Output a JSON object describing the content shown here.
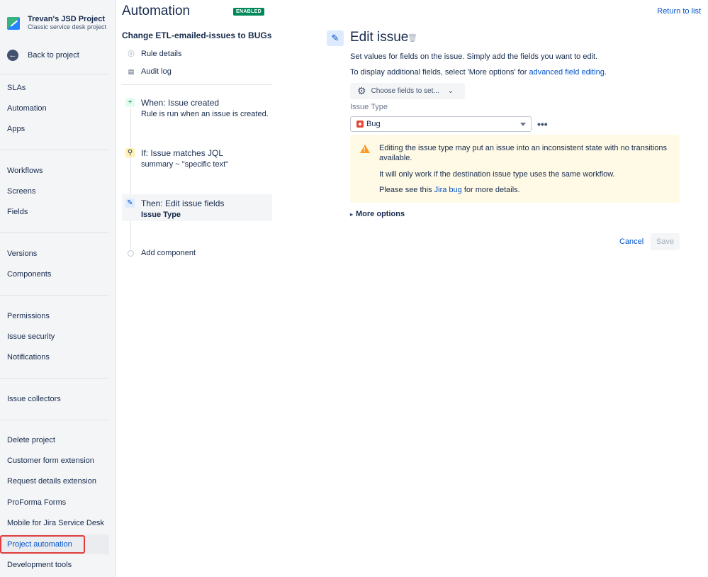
{
  "sidebar": {
    "project_name": "Trevan's JSD Project",
    "project_type": "Classic service desk project",
    "back_label": "Back to project",
    "groups": [
      [
        "SLAs",
        "Automation",
        "Apps"
      ],
      [
        "Workflows",
        "Screens",
        "Fields"
      ],
      [
        "Versions",
        "Components"
      ],
      [
        "Permissions",
        "Issue security",
        "Notifications"
      ],
      [
        "Issue collectors"
      ],
      [
        "Delete project",
        "Customer form extension",
        "Request details extension",
        "ProForma Forms",
        "Mobile for Jira Service Desk",
        "Project automation",
        "Development tools"
      ]
    ],
    "items": {
      "slas": "SLAs",
      "automation": "Automation",
      "apps": "Apps",
      "workflows": "Workflows",
      "screens": "Screens",
      "fields": "Fields",
      "versions": "Versions",
      "components": "Components",
      "permissions": "Permissions",
      "issue_security": "Issue security",
      "notifications": "Notifications",
      "issue_collectors": "Issue collectors",
      "delete_project": "Delete project",
      "customer_form_extension": "Customer form extension",
      "request_details_extension": "Request details extension",
      "proforma_forms": "ProForma Forms",
      "mobile_jsd": "Mobile for Jira Service Desk",
      "project_automation": "Project automation",
      "development_tools": "Development tools"
    }
  },
  "rule": {
    "page_title": "Automation",
    "status_badge": "ENABLED",
    "name": "Change ETL-emailed-issues to BUGs",
    "rule_details": "Rule details",
    "audit_log": "Audit log",
    "trigger": {
      "title": "When: Issue created",
      "sub": "Rule is run when an issue is created."
    },
    "condition": {
      "title": "If: Issue matches JQL",
      "sub": "summary ~ \"specific text\""
    },
    "action": {
      "title": "Then: Edit issue fields",
      "sub": "Issue Type"
    },
    "add_component": "Add component"
  },
  "editor": {
    "return_link": "Return to list",
    "title": "Edit issue",
    "desc1": "Set values for fields on the issue. Simply add the fields you want to edit.",
    "desc2_prefix": "To display additional fields, select 'More options' for ",
    "desc2_link": "advanced field editing.",
    "choose_fields": "Choose fields to set...",
    "field_label": "Issue Type",
    "field_value": "Bug",
    "warning": {
      "line1": "Editing the issue type may put an issue into an inconsistent state with no transitions",
      "line1b": "available.",
      "line2": "It will only work if the destination issue type uses the same workflow.",
      "line3_prefix": "Please see this ",
      "line3_link": "Jira bug",
      "line3_suffix": " for more details."
    },
    "more_options": "More options",
    "cancel": "Cancel",
    "save": "Save"
  },
  "colors": {
    "link": "#0052cc",
    "enabled_badge": "#00875a",
    "warning_bg": "#fffae6",
    "warning_icon": "#ff991f",
    "highlight_box": "#e03e3e"
  },
  "icons": [
    "project-logo-icon",
    "back-arrow-icon",
    "info-icon",
    "document-icon",
    "plus-icon",
    "search-icon",
    "pencil-icon",
    "trash-icon",
    "gear-icon",
    "chevron-down-icon",
    "bug-icon",
    "more-icon",
    "warning-icon",
    "chevron-right-icon"
  ]
}
